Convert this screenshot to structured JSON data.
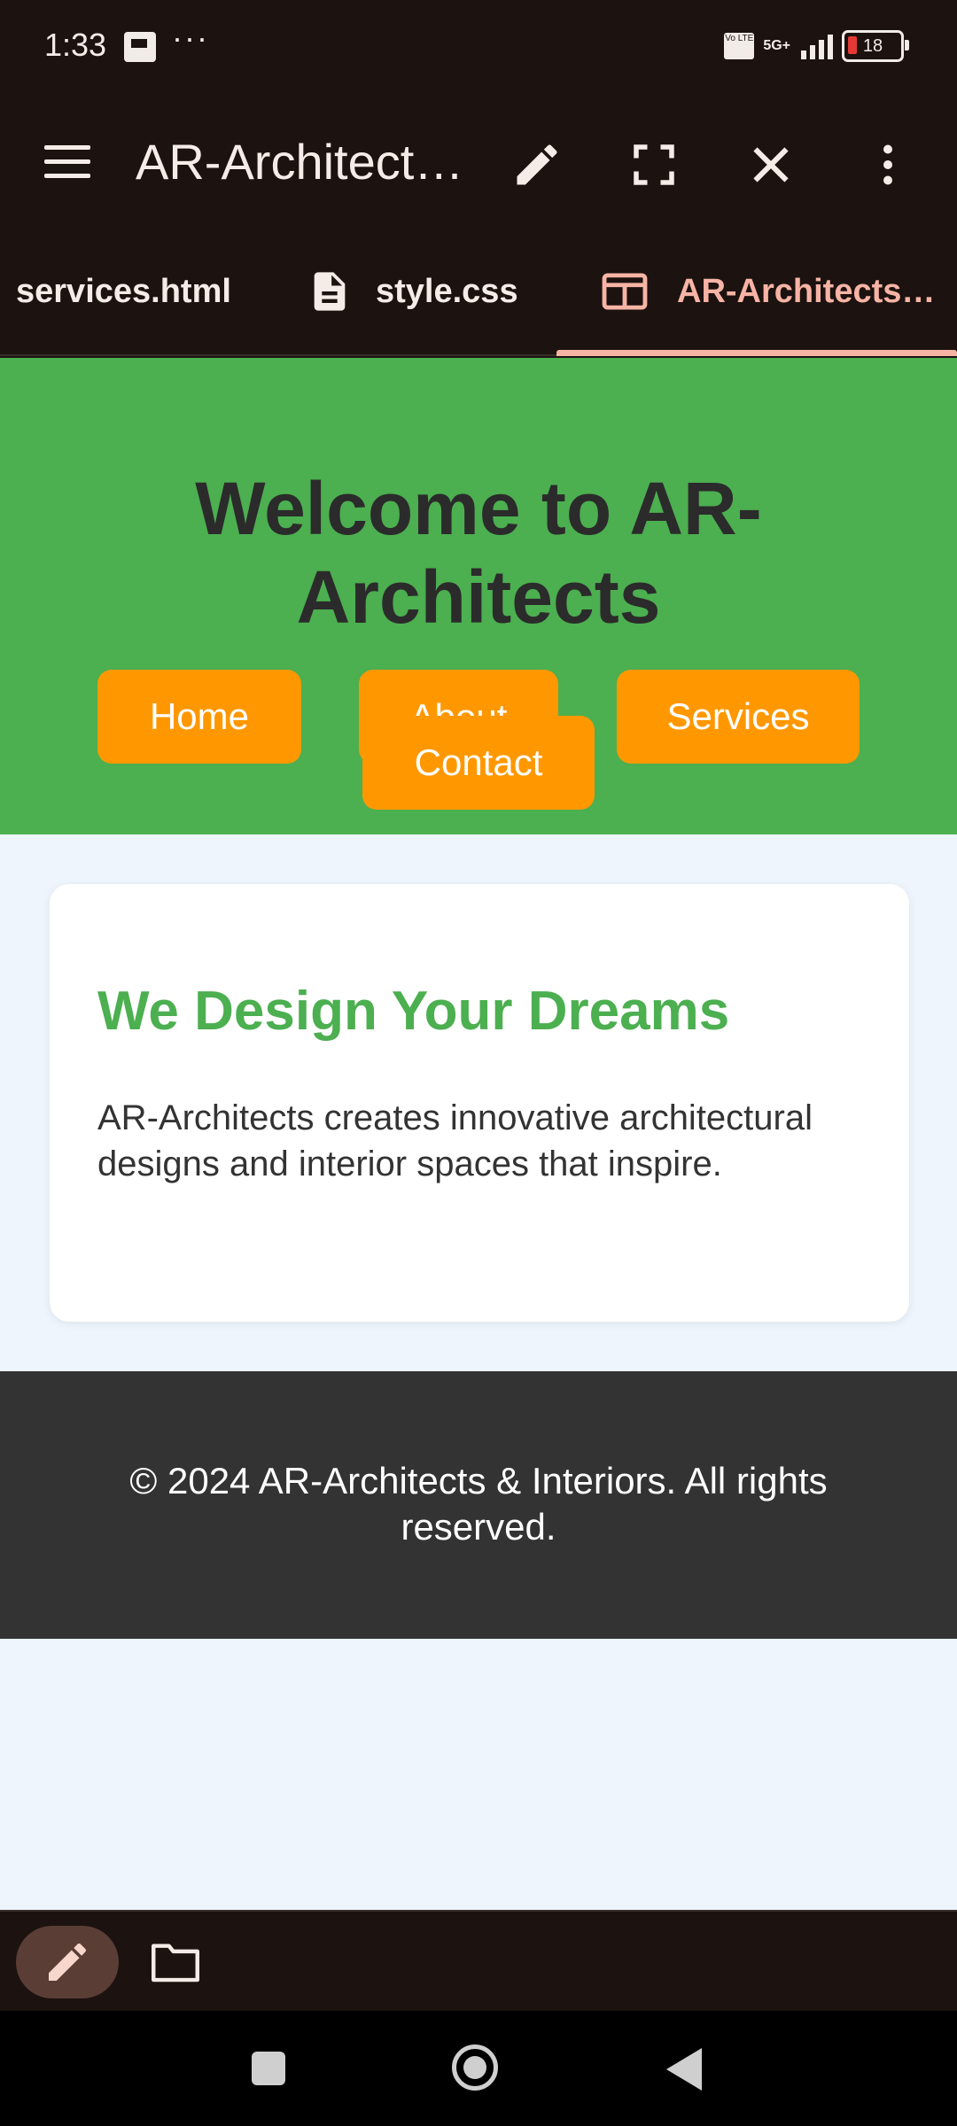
{
  "status_bar": {
    "time": "1:33",
    "dots": "···",
    "network_badge": "Vo LTE",
    "network_type": "5G+",
    "battery": "18"
  },
  "toolbar": {
    "title": "AR-Architect…",
    "icons": [
      "menu-icon",
      "pencil-icon",
      "fullscreen-icon",
      "close-icon",
      "more-vert-icon"
    ]
  },
  "tabs": [
    {
      "label": "services.html",
      "icon": null,
      "active": false
    },
    {
      "label": "style.css",
      "icon": "document-icon",
      "active": false
    },
    {
      "label": "AR-Architects…",
      "icon": "web-preview-icon",
      "active": true
    }
  ],
  "page": {
    "hero_title": "Welcome to AR-Architects",
    "nav": [
      "Home",
      "About",
      "Services",
      "Contact"
    ],
    "card_title": "We Design Your Dreams",
    "card_text": "AR-Architects creates innovative architectural designs and interior spaces that inspire.",
    "footer": "© 2024 AR-Architects & Interiors. All rights reserved."
  },
  "colors": {
    "app_bg": "#1c1210",
    "accent": "#f7b4a4",
    "hero_green": "#4caf50",
    "button_orange": "#ff9800",
    "footer_bg": "#333333",
    "page_bg": "#eef5fd"
  }
}
